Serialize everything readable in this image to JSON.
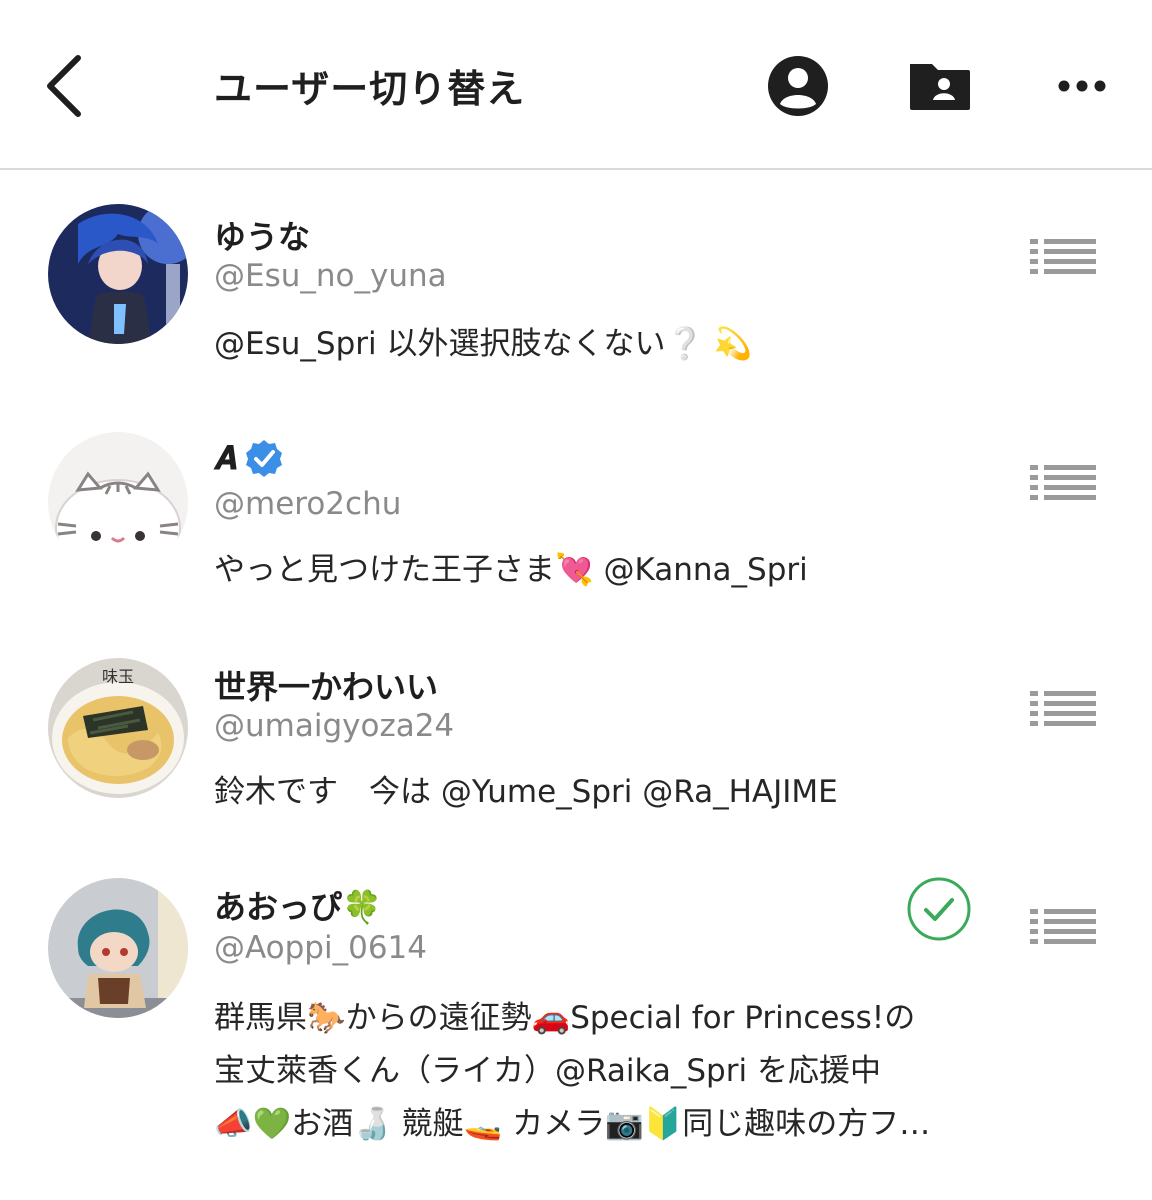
{
  "header": {
    "title": "ユーザー切り替え",
    "back_icon": "chevron-left-icon",
    "icons": [
      "profile-icon",
      "folder-user-icon",
      "more-icon"
    ]
  },
  "accounts": [
    {
      "name": "ゆうな",
      "handle": "@Esu_no_yuna",
      "bio_lines": [
        "@Esu_Spri 以外選択肢なくない❔ 💫"
      ],
      "verified": false,
      "selected": false
    },
    {
      "name": "𝑨",
      "handle": "@mero2chu",
      "bio_lines": [
        "やっと見つけた王子さま💘 @Kanna_Spri"
      ],
      "verified": true,
      "selected": false
    },
    {
      "name": "世界一かわいい",
      "handle": "@umaigyoza24",
      "bio_lines": [
        "鈴木です　今は @Yume_Spri @Ra_HAJIME"
      ],
      "verified": false,
      "selected": false
    },
    {
      "name": "あおっぴ🍀",
      "handle": "@Aoppi_0614",
      "bio_lines": [
        "群馬県🐎からの遠征勢🚗Special for Princess!の",
        "宝丈萊香くん（ライカ）@Raika_Spri を応援中",
        "📣💚お酒🍶 競艇🚤 カメラ📷🔰同じ趣味の方フ…"
      ],
      "verified": false,
      "selected": true
    }
  ],
  "colors": {
    "text": "#1f1f1f",
    "handle": "#8a8a8a",
    "verified": "#3b8fe6",
    "selected_check": "#3aaa5a",
    "reorder": "#9a9a9a",
    "divider": "#d9d9d9"
  }
}
